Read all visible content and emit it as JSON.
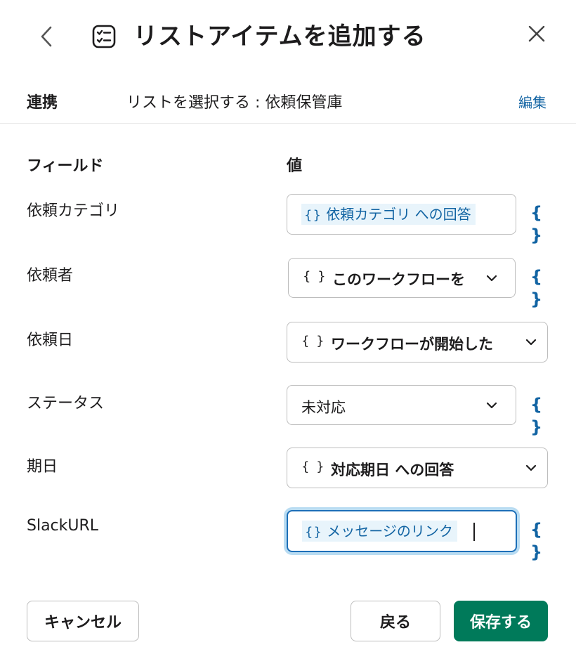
{
  "header": {
    "title": "リストアイテムを追加する"
  },
  "connection": {
    "label": "連携",
    "value": "リストを選択する : 依頼保管庫",
    "edit_label": "編集"
  },
  "columns": {
    "field": "フィールド",
    "value": "値"
  },
  "fields": {
    "category": {
      "label": "依頼カテゴリ",
      "brace": "{}",
      "chip_text": "依頼カテゴリ への回答"
    },
    "requester": {
      "label": "依頼者",
      "brace": "{ }",
      "value": "このワークフローを"
    },
    "request_date": {
      "label": "依頼日",
      "brace": "{ }",
      "value": "ワークフローが開始した"
    },
    "status": {
      "label": "ステータス",
      "value": "未対応"
    },
    "due_date": {
      "label": "期日",
      "brace": "{ }",
      "value": "対応期日 への回答"
    },
    "slack_url": {
      "label": "SlackURL",
      "brace": "{}",
      "chip_text": "メッセージのリンク"
    }
  },
  "insert_variable_label": "{ }",
  "footer": {
    "cancel_label": "キャンセル",
    "back_label": "戻る",
    "save_label": "保存する"
  },
  "colors": {
    "accent": "#1264a3",
    "primary_button": "#007a5a",
    "chip_bg": "#e8f4fb",
    "focus_ring": "#b9dcf2"
  },
  "icons": {
    "back": "chevron-left-icon",
    "list": "checklist-icon",
    "close": "close-icon",
    "dropdown": "chevron-down-icon"
  }
}
